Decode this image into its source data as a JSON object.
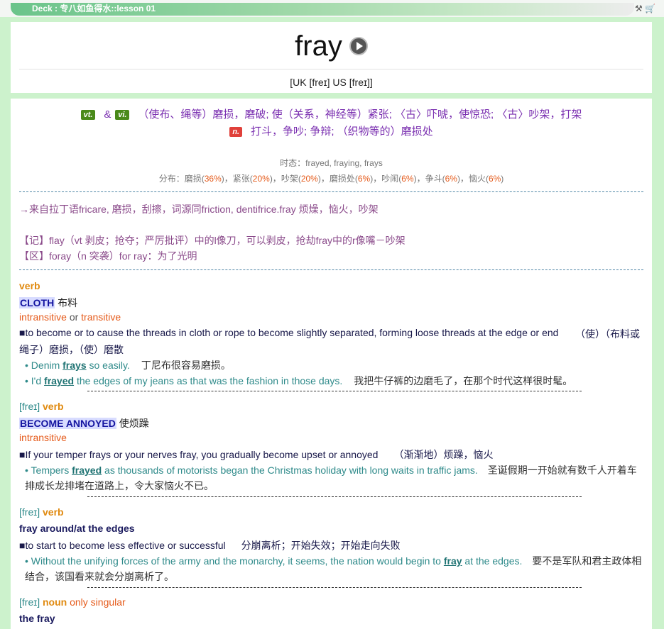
{
  "deck_title": "Deck : 专八如鱼得水::lesson 01",
  "tools_icons": [
    "tool-icon",
    "cart-icon"
  ],
  "word": "fray",
  "phonetic": "[UK [freɪ] US [freɪ]]",
  "pos1": "vt.",
  "amp": "&",
  "pos2": "vi.",
  "def1": "（使布、绳等）磨损，磨破; 使（关系，神经等）紧张; 〈古〉吓唬，使惊恐; 〈古〉吵架，打架",
  "pos3": "n.",
  "def2": "打斗，争吵; 争辩; （织物等的）磨损处",
  "tense_label": "时态：",
  "tense_value": "frayed, fraying, frays",
  "dist_label": "分布：",
  "dist": [
    {
      "w": "磨损",
      "p": "36%"
    },
    {
      "w": "紧张",
      "p": "20%"
    },
    {
      "w": "吵架",
      "p": "20%"
    },
    {
      "w": "磨损处",
      "p": "6%"
    },
    {
      "w": "吵闹",
      "p": "6%"
    },
    {
      "w": "争斗",
      "p": "6%"
    },
    {
      "w": "恼火",
      "p": "6%"
    }
  ],
  "etym": "→来自拉丁语fricare, 磨损，刮擦，词源同friction, dentifrice.fray 烦燥，恼火，吵架",
  "mem1": "【记】flay（vt 剥皮；抢夺；严厉批评）中的l像刀，可以剥皮，抢劫fray中的r像嘴－吵架",
  "mem2": "【区】foray（n 突袭）for ray：为了光明",
  "s1": {
    "label": "verb",
    "guide": "CLOTH",
    "guide_cn": "布料",
    "gram_a": "intransitive",
    "gram_or": "or",
    "gram_b": "transitive",
    "def": "■to become or to cause the threads in cloth or rope to become slightly separated, forming loose threads at the edge or end",
    "def_cn1": "（使）（布料或",
    "def_cn2": "绳子）磨损，（使）磨散",
    "ex1_pre": "• Denim ",
    "ex1_kw": "frays",
    "ex1_post": " so easily.",
    "ex1_cn": "丁尼布很容易磨损。",
    "ex2_pre": "• I'd ",
    "ex2_kw": "frayed",
    "ex2_post": " the edges of my jeans as that was the fashion in those days.",
    "ex2_cn": "我把牛仔裤的边磨毛了，在那个时代这样很时髦。"
  },
  "s2": {
    "pron": "[freɪ]",
    "label": "verb",
    "guide": "BECOME ANNOYED",
    "guide_cn": "使烦躁",
    "gram": "intransitive",
    "def": "■If your temper frays or your nerves fray, you gradually become upset or annoyed",
    "def_cn": "（渐渐地）烦躁，恼火",
    "ex_pre": "• Tempers ",
    "ex_kw": "frayed",
    "ex_post": " as thousands of motorists began the Christmas holiday with long waits in traffic jams.",
    "ex_cn1": "圣诞假期一开始就有数千人开着车",
    "ex_cn2": "排成长龙排堵在道路上，令大家恼火不已。"
  },
  "s3": {
    "pron": "[freɪ]",
    "label": "verb",
    "phrase": "fray around/at the edges",
    "def": "■to start to become less effective or successful",
    "def_cn": "分崩离析；开始失效；开始走向失败",
    "ex_pre": "• Without the unifying forces of the army and the monarchy, it seems, the nation would begin to ",
    "ex_kw": "fray",
    "ex_post": " at the edges.",
    "ex_cn1": "要不是军队和君主政体相",
    "ex_cn2": "结合，该国看来就会分崩离析了。"
  },
  "s4": {
    "pron": "[freɪ]",
    "label": "noun",
    "gram": "only singular",
    "phrase": "the fray"
  }
}
